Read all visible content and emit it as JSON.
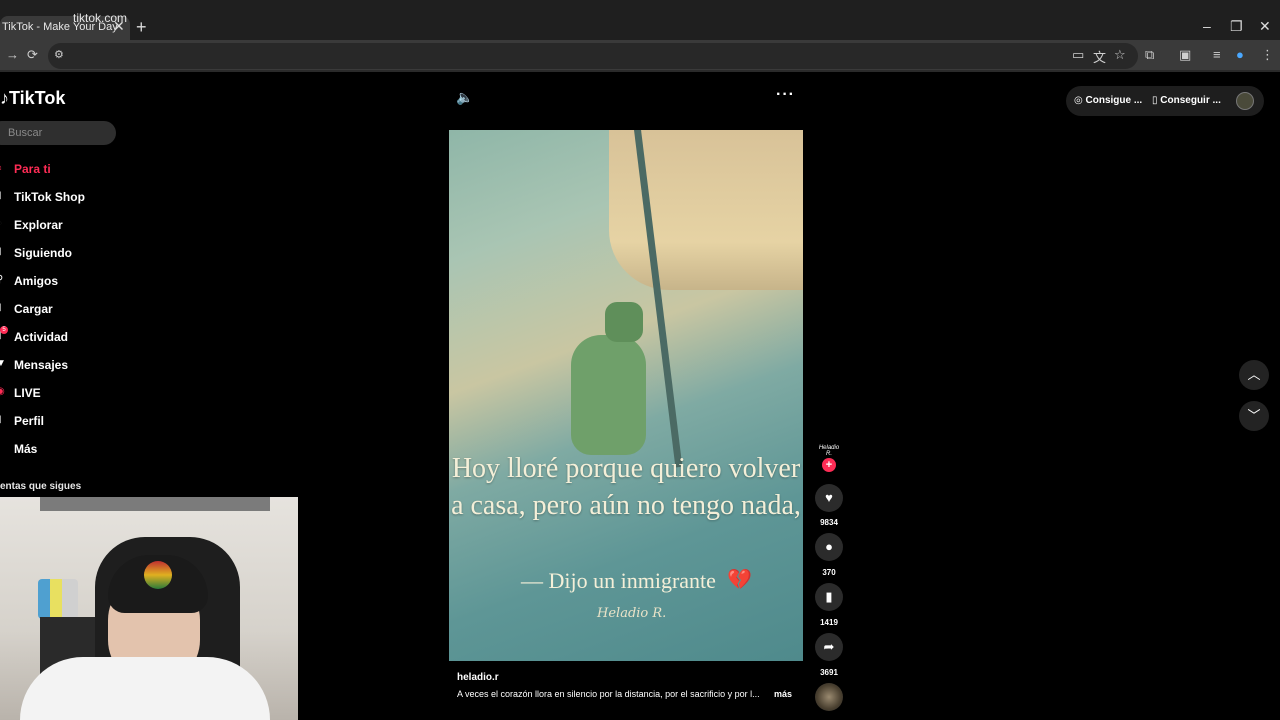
{
  "browser": {
    "tab_title": "TikTok - Make Your Day",
    "tab_close": "✕",
    "new_tab": "+",
    "url": "tiktok.com",
    "controls": {
      "minimize": "–",
      "restore": "❐",
      "close": "✕"
    }
  },
  "sidebar": {
    "logo": "TikTok",
    "search_placeholder": "Buscar",
    "items": [
      {
        "label": "Para ti",
        "icon": "home-icon",
        "active": true
      },
      {
        "label": "TikTok Shop",
        "icon": "shop-icon"
      },
      {
        "label": "Explorar",
        "icon": "compass-icon"
      },
      {
        "label": "Siguiendo",
        "icon": "following-icon"
      },
      {
        "label": "Amigos",
        "icon": "friends-icon"
      },
      {
        "label": "Cargar",
        "icon": "upload-icon"
      },
      {
        "label": "Actividad",
        "icon": "activity-icon",
        "badge": "5"
      },
      {
        "label": "Mensajes",
        "icon": "message-icon"
      },
      {
        "label": "LIVE",
        "icon": "live-icon"
      },
      {
        "label": "Perfil",
        "icon": "profile-icon"
      },
      {
        "label": "Más",
        "icon": "more-icon"
      }
    ],
    "following_title": "entas que sigues"
  },
  "header": {
    "get_coins": "Consigue ...",
    "get_app": "Conseguir ..."
  },
  "video": {
    "text": "Hoy lloré porque quiero volver a casa, pero aún no tengo nada,",
    "quote": "— Dijo un inmigrante",
    "signature": "Heladio R.",
    "creator_sig": "Heladio R."
  },
  "post": {
    "author": "heladio.r",
    "caption": "A veces el corazón llora en silencio por la distancia, por el sacrificio y por l...",
    "more": "más"
  },
  "actions": {
    "likes": "9834",
    "comments": "370",
    "saves": "1419",
    "shares": "3691"
  },
  "colors": {
    "accent": "#fe2c55",
    "background": "#000000"
  }
}
